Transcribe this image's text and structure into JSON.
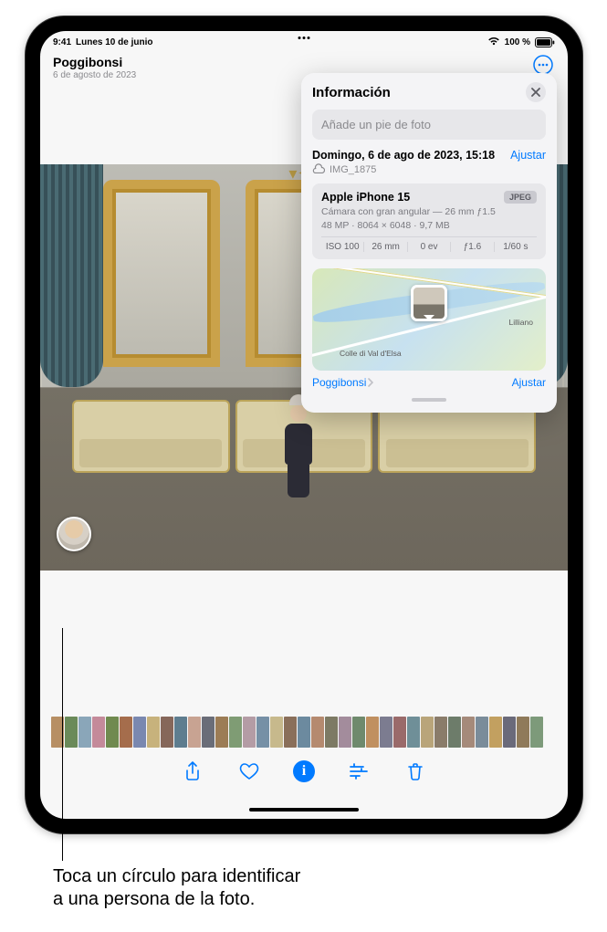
{
  "status_bar": {
    "time": "9:41",
    "date": "Lunes 10 de junio",
    "battery_pct": "100 %"
  },
  "header": {
    "title": "Poggibonsi",
    "subtitle": "6 de agosto de 2023"
  },
  "popover": {
    "title": "Información",
    "caption_placeholder": "Añade un pie de foto",
    "datetime": "Domingo, 6 de ago de 2023, 15:18",
    "adjust_label": "Ajustar",
    "filename": "IMG_1875",
    "device": "Apple iPhone 15",
    "format_badge": "JPEG",
    "lens_line": "Cámara con gran angular — 26 mm ƒ1.5",
    "specs_line": "48 MP · 8064 × 6048 · 9,7 MB",
    "exif": {
      "iso": "ISO 100",
      "focal": "26 mm",
      "ev": "0 ev",
      "aperture": "ƒ1.6",
      "shutter": "1/60 s"
    },
    "map": {
      "label_city1": "Colle di Val d'Elsa",
      "label_city2": "Lilliano",
      "location_link": "Poggibonsi",
      "adjust_label": "Ajustar"
    }
  },
  "thumb_colors": [
    "#b78f64",
    "#6a8a59",
    "#8aa6b9",
    "#c48a9a",
    "#708a4f",
    "#a56d4c",
    "#7a88b0",
    "#c7b27c",
    "#86675a",
    "#5e7d8f",
    "#c8a392",
    "#6a6d78",
    "#9c7c55",
    "#7f9c74",
    "#b49ca5",
    "#7690a6",
    "#c7b98c",
    "#8a6f5a",
    "#6c8a9f",
    "#b58a6f",
    "#7d7a64",
    "#a38c9c",
    "#6f8a6d",
    "#c09060",
    "#7c7c90",
    "#9a6a6a",
    "#6f8f98",
    "#b9a57a",
    "#8a7c6a",
    "#6d7c6a",
    "#a58a7a",
    "#7a8c9a",
    "#c2a060",
    "#6a6a7a",
    "#8f7a5a",
    "#7d9a7a"
  ],
  "callout": {
    "line1": "Toca un círculo para identificar",
    "line2": "a una persona de la foto."
  }
}
